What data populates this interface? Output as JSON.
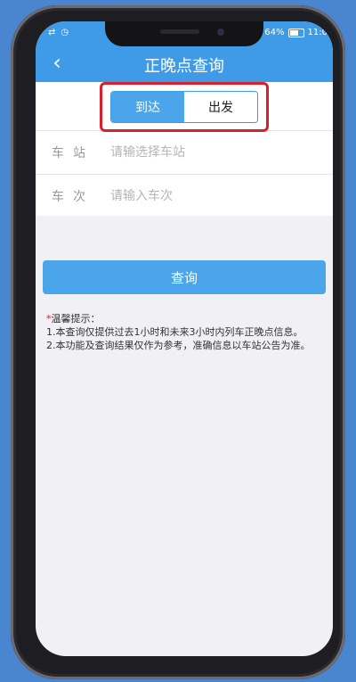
{
  "status_bar": {
    "left_icons": [
      "usb-icon",
      "clock-icon"
    ],
    "battery": "64%",
    "time": "11:0"
  },
  "nav": {
    "back_icon": "chevron-left-icon",
    "title": "正晚点查询"
  },
  "tabs": [
    {
      "label": "到达",
      "active": true
    },
    {
      "label": "出发",
      "active": false
    }
  ],
  "form": {
    "station_label": "车站",
    "station_placeholder": "请输选择车站",
    "train_label": "车次",
    "train_placeholder": "请输入车次"
  },
  "query_button_label": "查询",
  "tips": {
    "star": "*",
    "title": "温馨提示：",
    "lines": [
      "1.本查询仅提供过去1小时和未来3小时内列车正晚点信息。",
      "2.本功能及查询结果仅作为参考，准确信息以车站公告为准。"
    ]
  },
  "colors": {
    "accent": "#3f9be8",
    "button": "#4aa5ea",
    "highlight": "#d9202a",
    "background": "#f0f0f5"
  }
}
